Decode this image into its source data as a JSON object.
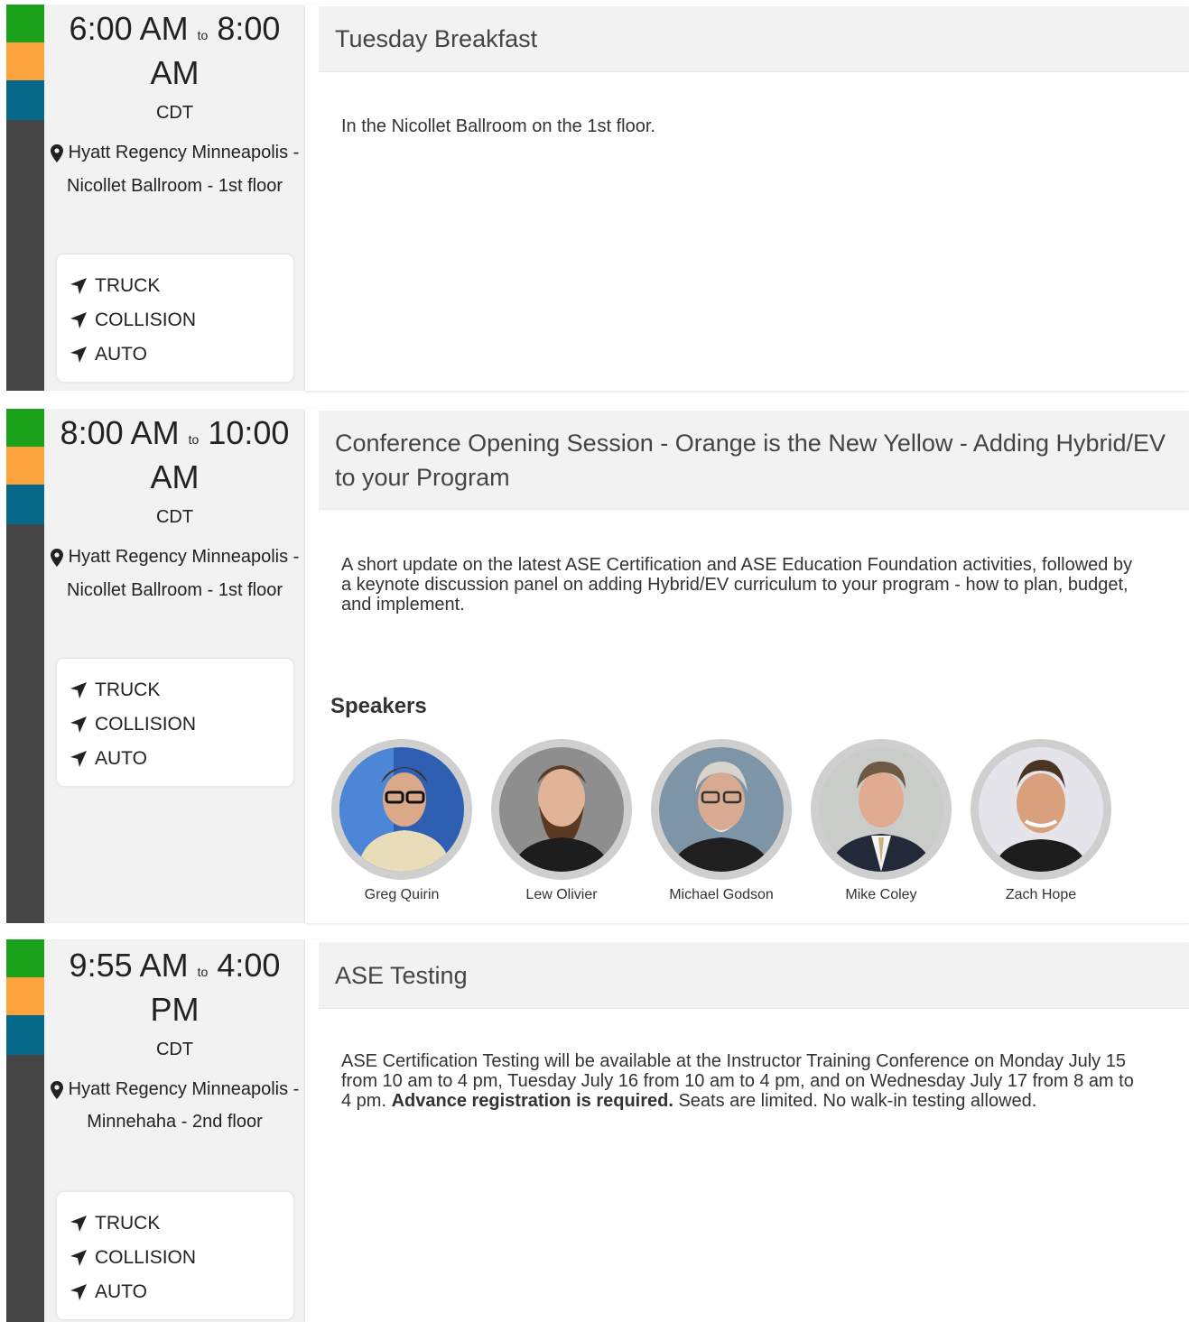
{
  "colors": {
    "green": "#1aa11a",
    "orange": "#fba33a",
    "teal": "#06698a",
    "dark": "#454545"
  },
  "icons": {
    "location": "map-pin-icon",
    "track": "navigation-arrow-icon"
  },
  "sessions": [
    {
      "start": "6:00 AM",
      "to": "to",
      "end": "8:00 AM",
      "tz": "CDT",
      "location": "Hyatt Regency Minneapolis - Nicollet Ballroom - 1st floor",
      "tracks": [
        "TRUCK",
        "COLLISION",
        "AUTO"
      ],
      "title": "Tuesday Breakfast",
      "description": "In the Nicollet Ballroom on the 1st floor."
    },
    {
      "start": "8:00 AM",
      "to": "to",
      "end": "10:00 AM",
      "tz": "CDT",
      "location": "Hyatt Regency Minneapolis - Nicollet Ballroom - 1st floor",
      "tracks": [
        "TRUCK",
        "COLLISION",
        "AUTO"
      ],
      "title": "Conference Opening Session - Orange is the New Yellow - Adding Hybrid/EV to your Program",
      "description": "A short update on the latest ASE Certification and ASE Education Foundation activities, followed by a keynote discussion panel on adding Hybrid/EV curriculum to your program - how to plan, budget, and implement.",
      "speakers_heading": "Speakers",
      "speakers": [
        "Greg Quirin",
        "Lew Olivier",
        "Michael Godson",
        "Mike Coley",
        "Zach Hope"
      ]
    },
    {
      "start": "9:55 AM",
      "to": "to",
      "end": "4:00 PM",
      "tz": "CDT",
      "location": "Hyatt Regency Minneapolis - Minnehaha - 2nd floor",
      "tracks": [
        "TRUCK",
        "COLLISION",
        "AUTO"
      ],
      "title": "ASE Testing",
      "description_pre": "ASE Certification Testing will be available at the Instructor Training Conference on Monday July 15 from 10 am to 4 pm, Tuesday July 16 from 10 am to 4 pm, and on Wednesday July 17 from 8 am to 4 pm. ",
      "description_bold": "Advance registration is required.",
      "description_post": " Seats are limited. No walk-in testing allowed."
    }
  ]
}
